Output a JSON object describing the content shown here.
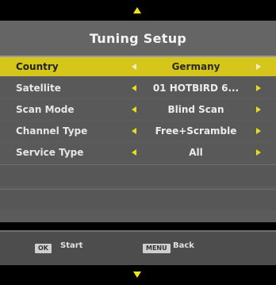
{
  "menu": {
    "title": "Tuning Setup",
    "rows": [
      {
        "label": "Country",
        "value": "Germany",
        "selected": true
      },
      {
        "label": "Satellite",
        "value": "01 HOTBIRD 6...",
        "selected": false
      },
      {
        "label": "Scan Mode",
        "value": "Blind Scan",
        "selected": false
      },
      {
        "label": "Channel Type",
        "value": "Free+Scramble",
        "selected": false
      },
      {
        "label": "Service Type",
        "value": "All",
        "selected": false
      }
    ]
  },
  "footer": {
    "ok_key": "OK",
    "ok_label": "Start",
    "menu_key": "MENU",
    "menu_label": "Back"
  },
  "colors": {
    "highlight": "#d6c51a",
    "arrow": "#e8dc1e",
    "panel": "#5b5b5b",
    "title_bar": "#656565"
  },
  "icons": {
    "scroll_up": "triangle-up-icon",
    "scroll_down": "triangle-down-icon",
    "option_prev": "triangle-left-icon",
    "option_next": "triangle-right-icon"
  }
}
